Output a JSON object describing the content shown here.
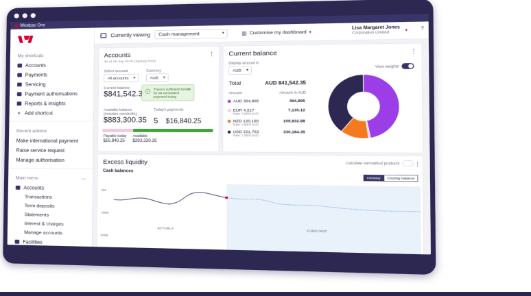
{
  "window": {
    "title": "Westpac One"
  },
  "sidebar": {
    "shortcuts_title": "My shortcuts",
    "shortcuts": [
      {
        "label": "Accounts",
        "icon": "accounts-icon"
      },
      {
        "label": "Payments",
        "icon": "payments-icon"
      },
      {
        "label": "Servicing",
        "icon": "servicing-icon"
      },
      {
        "label": "Payment authorisations",
        "icon": "authorisations-icon"
      },
      {
        "label": "Reports & insights",
        "icon": "reports-icon"
      },
      {
        "label": "Add shortcut",
        "icon": "plus-icon"
      }
    ],
    "recent_title": "Recent actions",
    "recent": [
      "Make international payment",
      "Raise service request",
      "Manage authorisation"
    ],
    "menu_title": "Main menu",
    "menu_accounts": "Accounts",
    "menu_sub": [
      "Transactions",
      "Term deposits",
      "Statements",
      "Interest & charges",
      "Manage accounts"
    ],
    "menu_facilities": "Facilities"
  },
  "topbar": {
    "viewing_label": "Currently viewing",
    "viewing_value": "Cash management",
    "customise_label": "Customise my dashboard",
    "user_name": "Lisa Margaret Jones",
    "user_org": "Corporation Limited"
  },
  "accounts": {
    "title": "Accounts",
    "as_of": "As of 28 July 09:00 (Sydney time)",
    "select_label": "Select account",
    "select_value": "All accounts",
    "currency_label": "Currency",
    "currency_value": "AUD",
    "current_balance_label": "Current balance",
    "current_balance": "$841,542.35",
    "alert_text": "There's sufficient funds for all scheduled payment today",
    "available_label": "Available balance (includes overdrafts)",
    "available": "$883,300.35",
    "todays_payments_label": "Today's payments",
    "todays_payments_count": "5",
    "todays_payments_amount": "$16,840.25",
    "payable_label": "Payable today",
    "payable_value": "$16,840.25",
    "avail_label": "Available",
    "avail_value": "$393,330.35"
  },
  "balance": {
    "title": "Current balance",
    "display_label": "Display amount in",
    "display_value": "AUD",
    "total_label": "Total",
    "total_value": "AUD 841,542.35",
    "view_weights_label": "View weights",
    "col_amount": "Amount",
    "col_aud": "Amount in AUD",
    "rows": [
      {
        "label": "AUD 394,895",
        "rate": "",
        "aud": "394,895",
        "color": "#9b3ee8"
      },
      {
        "label": "EUR 4,317",
        "rate": "Rate: 0.6599 AUD",
        "aud": "7,130.12",
        "color": "#f2c7e6"
      },
      {
        "label": "NZD 120,160",
        "rate": "Rate: 0.6600 AUD",
        "aud": "109,932.88",
        "color": "#f47a20"
      },
      {
        "label": "USD 221,763",
        "rate": "Rate: 1.5600 AUD",
        "aud": "330,184.35",
        "color": "#2d2852"
      }
    ]
  },
  "liquidity": {
    "title": "Excess liquidity",
    "subtitle": "Cash balances",
    "calc_label": "Calculate earmarked products",
    "seg_a": "Intraday",
    "seg_b": "Closing balance",
    "y_labels": [
      "1M",
      "750K",
      "500K"
    ],
    "actuals_label": "ACTUALS",
    "forecast_label": "FORECAST"
  },
  "chart_data": {
    "type": "pie",
    "title": "Current balance",
    "categories": [
      "AUD",
      "EUR",
      "NZD",
      "USD"
    ],
    "values": [
      394895,
      7130.12,
      109932.88,
      330184.35
    ],
    "colors": [
      "#9b3ee8",
      "#f2c7e6",
      "#f47a20",
      "#2d2852"
    ]
  },
  "colors": {
    "brand_red": "#d5002b",
    "brand_navy": "#2d2852",
    "accent_purple": "#9b3ee8",
    "ok_green": "#3aa534"
  }
}
